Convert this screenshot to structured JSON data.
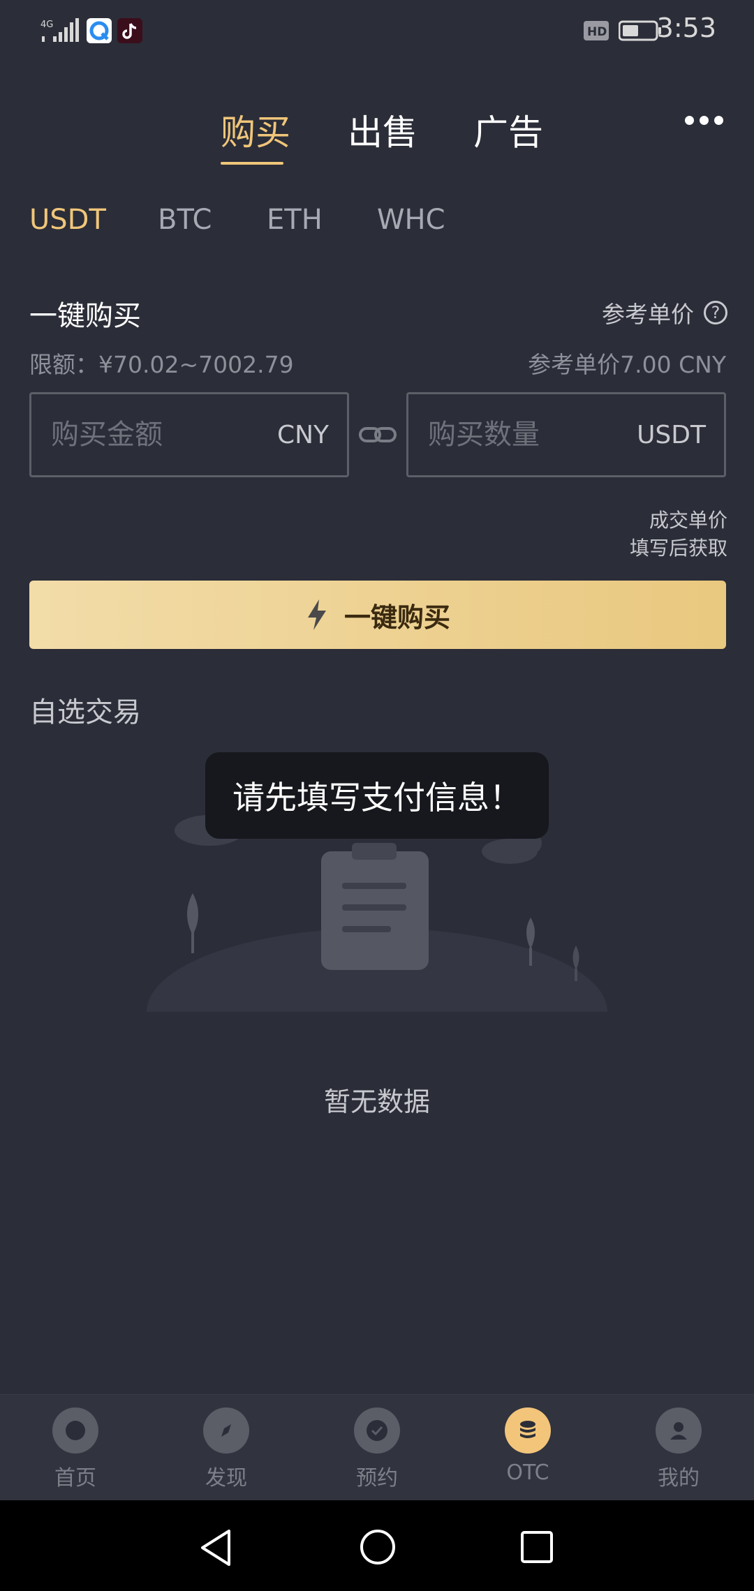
{
  "status_bar": {
    "network": "4G",
    "time": "3:53",
    "hd_badge": "HD",
    "icons": [
      "signal-icon",
      "browser-app-icon",
      "tiktok-app-icon",
      "hd-icon",
      "battery-icon"
    ]
  },
  "header": {
    "tabs": [
      {
        "label": "购买",
        "active": true
      },
      {
        "label": "出售",
        "active": false
      },
      {
        "label": "广告",
        "active": false
      }
    ],
    "more_icon": "more-dots-icon"
  },
  "coin_tabs": [
    {
      "label": "USDT",
      "active": true
    },
    {
      "label": "BTC",
      "active": false
    },
    {
      "label": "ETH",
      "active": false
    },
    {
      "label": "WHC",
      "active": false
    }
  ],
  "quick_buy": {
    "title": "一键购买",
    "ref_label": "参考单价",
    "help_icon": "question-icon",
    "limit": "限额：¥70.02~7002.79",
    "ref_price": "参考单价7.00 CNY",
    "amount": {
      "placeholder": "购买金额",
      "value": "",
      "unit": "CNY"
    },
    "quantity": {
      "placeholder": "购买数量",
      "value": "",
      "unit": "USDT"
    },
    "deal_price_line1": "成交单价",
    "deal_price_line2": "填写后获取",
    "button_label": "一键购买"
  },
  "favorites": {
    "title": "自选交易",
    "empty_text": "暂无数据"
  },
  "toast": {
    "message": "请先填写支付信息！"
  },
  "bottom_nav": [
    {
      "label": "首页",
      "icon": "home-icon",
      "active": false
    },
    {
      "label": "发现",
      "icon": "compass-icon",
      "active": false
    },
    {
      "label": "预约",
      "icon": "check-icon",
      "active": false
    },
    {
      "label": "OTC",
      "icon": "coins-stack-icon",
      "active": true
    },
    {
      "label": "我的",
      "icon": "user-icon",
      "active": false
    }
  ],
  "colors": {
    "accent": "#f0c67a",
    "background": "#2b2d38",
    "button_gradient_start": "#f2dca8",
    "button_gradient_end": "#e9c87f"
  }
}
